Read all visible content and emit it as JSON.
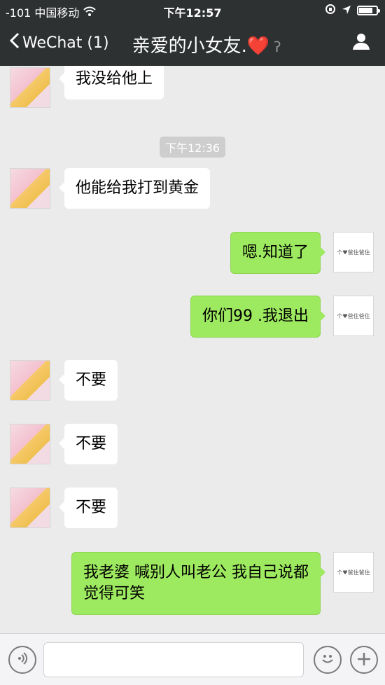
{
  "status_bar": {
    "carrier": "-101 中国移动",
    "time": "下午12:57",
    "icons": [
      "wifi-icon",
      "orientation-lock-icon",
      "location-icon",
      "battery-icon"
    ],
    "battery_level": 0.8
  },
  "nav": {
    "back_label": "WeChat (1)",
    "title": "亲爱的小女友.",
    "title_emoji": "❤️",
    "profile_icon": "profile-icon",
    "ear_icon": "earpiece-icon"
  },
  "messages": [
    {
      "side": "in",
      "text": "我没给他上"
    },
    {
      "type": "timestamp",
      "text": "下午12:36"
    },
    {
      "side": "in",
      "text": "他能给我打到黄金"
    },
    {
      "side": "out",
      "text": "嗯.知道了"
    },
    {
      "side": "out",
      "text": "你们99 .我退出"
    },
    {
      "side": "in",
      "text": "不要"
    },
    {
      "side": "in",
      "text": "不要"
    },
    {
      "side": "in",
      "text": "不要"
    },
    {
      "side": "out",
      "text": "我老婆 喊别人叫老公 我自己说都觉得可笑"
    }
  ],
  "my_avatar_text": "个♥爸住爸住",
  "input_bar": {
    "placeholder": "",
    "icons": [
      "voice-icon",
      "emoji-icon",
      "plus-icon"
    ]
  },
  "colors": {
    "header": "#2e3132",
    "chat_bg": "#ebebeb",
    "out_bubble": "#9de95f",
    "in_bubble": "#ffffff"
  }
}
